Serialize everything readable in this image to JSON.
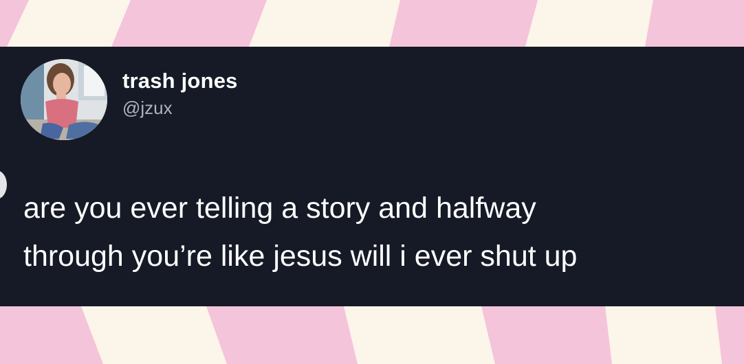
{
  "background": {
    "pattern": "checkerboard",
    "colors": [
      "#f4c4da",
      "#fcf5ea"
    ]
  },
  "tweet": {
    "author": {
      "display_name": "trash jones",
      "handle": "@jzux",
      "avatar_icon": "profile-photo"
    },
    "text": "are you ever telling a story and halfway\nthrough you’re like jesus will i ever shut up",
    "card_color": "#151a26",
    "text_color": "#ffffff",
    "handle_color": "#aeb4bd"
  }
}
